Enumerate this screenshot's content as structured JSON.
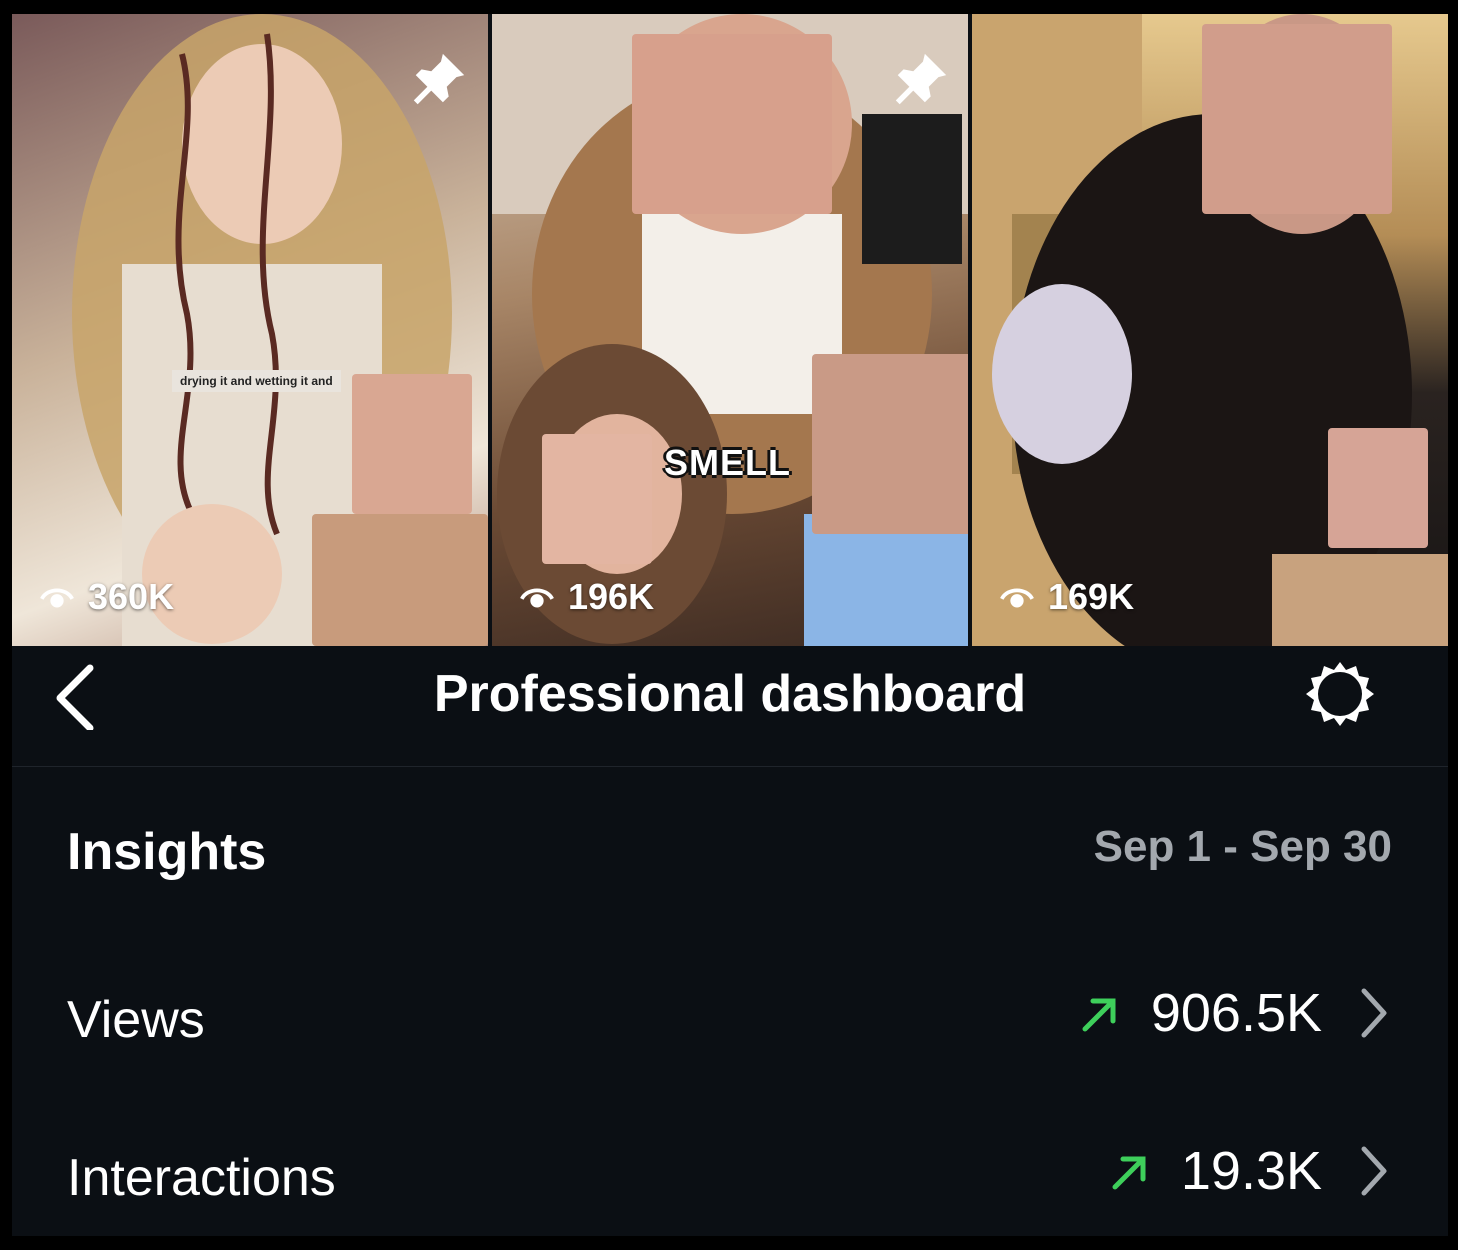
{
  "videos": [
    {
      "views": "360K",
      "caption": "drying it and wetting it and",
      "pinned": true
    },
    {
      "views": "196K",
      "caption": "SMELL",
      "pinned": true
    },
    {
      "views": "169K",
      "pinned": false
    }
  ],
  "header": {
    "title": "Professional dashboard"
  },
  "insights": {
    "title": "Insights",
    "date_range": "Sep 1 - Sep 30",
    "metrics": [
      {
        "label": "Views",
        "value": "906.5K",
        "trend": "up"
      },
      {
        "label": "Interactions",
        "value": "19.3K",
        "trend": "up"
      }
    ]
  },
  "colors": {
    "background": "#0b0f14",
    "trend_up": "#3ecf5b",
    "secondary_text": "#a3a8ae"
  },
  "icons": {
    "back": "chevron-left-icon",
    "settings": "gear-icon",
    "pin": "pin-icon",
    "views": "eye-icon",
    "trend": "arrow-up-right-icon",
    "open": "chevron-right-icon"
  }
}
